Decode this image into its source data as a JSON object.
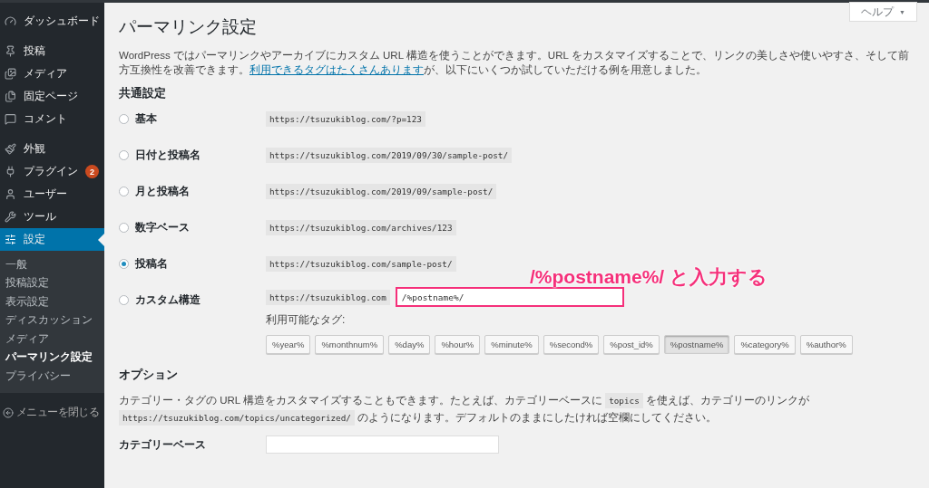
{
  "sidebar": {
    "menu_groups": [
      {
        "items": [
          {
            "label": "ダッシュボード",
            "selected": false
          }
        ]
      },
      {
        "items": [
          {
            "label": "投稿",
            "selected": false
          },
          {
            "label": "メディア",
            "selected": false
          },
          {
            "label": "固定ページ",
            "selected": false
          },
          {
            "label": "コメント",
            "selected": false
          }
        ]
      },
      {
        "items": [
          {
            "label": "外観",
            "selected": false
          },
          {
            "label": "プラグイン",
            "badge": "2",
            "selected": false
          },
          {
            "label": "ユーザー",
            "selected": false
          },
          {
            "label": "ツール",
            "selected": false
          },
          {
            "label": "設定",
            "selected": true
          }
        ]
      }
    ],
    "submenu": [
      {
        "label": "一般",
        "selected": false
      },
      {
        "label": "投稿設定",
        "selected": false
      },
      {
        "label": "表示設定",
        "selected": false
      },
      {
        "label": "ディスカッション",
        "selected": false
      },
      {
        "label": "メディア",
        "selected": false
      },
      {
        "label": "パーマリンク設定",
        "selected": true
      },
      {
        "label": "プライバシー",
        "selected": false
      }
    ],
    "collapse": "メニューを閉じる"
  },
  "help_button": {
    "label": "ヘルプ",
    "caret": "▼"
  },
  "title": "パーマリンク設定",
  "description": [
    {
      "kind": "text",
      "text": "WordPress ではパーマリンクやアーカイブにカスタム URL 構造を使うことができます。URL をカスタマイズすることで、リンクの美しさや使いやすさ、そして前方互換性を改善できます。"
    },
    {
      "kind": "link",
      "text": "利用できるタグはたくさんあります"
    },
    {
      "kind": "text",
      "text": "が、以下にいくつか試していただける例を用意しました。"
    }
  ],
  "common_heading": "共通設定",
  "options": [
    {
      "label": "基本",
      "example": "https://tsuzukiblog.com/?p=123",
      "selected": false
    },
    {
      "label": "日付と投稿名",
      "example": "https://tsuzukiblog.com/2019/09/30/sample-post/",
      "selected": false
    },
    {
      "label": "月と投稿名",
      "example": "https://tsuzukiblog.com/2019/09/sample-post/",
      "selected": false
    },
    {
      "label": "数字ベース",
      "example": "https://tsuzukiblog.com/archives/123",
      "selected": false
    },
    {
      "label": "投稿名",
      "example": "https://tsuzukiblog.com/sample-post/",
      "selected": true
    }
  ],
  "custom": {
    "label": "カスタム構造",
    "selected": false,
    "prefix": "https://tsuzukiblog.com",
    "value": "/%postname%/",
    "highlighted": true,
    "tags_label": "利用可能なタグ:",
    "tags": [
      {
        "label": "%year%",
        "selected": false
      },
      {
        "label": "%monthnum%",
        "selected": false
      },
      {
        "label": "%day%",
        "selected": false
      },
      {
        "label": "%hour%",
        "selected": false
      },
      {
        "label": "%minute%",
        "selected": false
      },
      {
        "label": "%second%",
        "selected": false
      },
      {
        "label": "%post_id%",
        "selected": false
      },
      {
        "label": "%postname%",
        "selected": true
      },
      {
        "label": "%category%",
        "selected": false
      },
      {
        "label": "%author%",
        "selected": false
      }
    ]
  },
  "annotation": "/%postname%/ と入力する",
  "options_heading": "オプション",
  "options_description": [
    {
      "kind": "text",
      "text": "カテゴリー・タグの URL 構造をカスタマイズすることもできます。たとえば、カテゴリーベースに "
    },
    {
      "kind": "code",
      "text": "topics"
    },
    {
      "kind": "text",
      "text": " を使えば、カテゴリーのリンクが "
    },
    {
      "kind": "code",
      "text": "https://tsuzukiblog.com/topics/uncategorized/"
    },
    {
      "kind": "text",
      "text": " のようになります。デフォルトのままにしたければ空欄にしてください。"
    }
  ],
  "category_base": {
    "label": "カテゴリーベース"
  }
}
